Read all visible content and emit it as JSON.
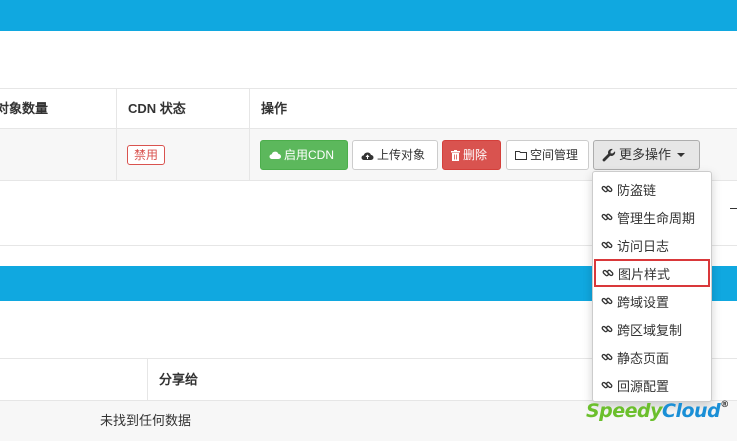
{
  "table1": {
    "headers": {
      "object_count": "对象数量",
      "cdn_status": "CDN 状态",
      "actions": "操作"
    },
    "row": {
      "cdn_status_badge": "禁用",
      "buttons": {
        "enable_cdn": "启用CDN",
        "upload": "上传对象",
        "delete": "删除",
        "space_manage": "空间管理",
        "more_actions": "更多操作"
      }
    }
  },
  "dropdown": {
    "items": [
      {
        "label": "防盗链",
        "icon": "link-icon"
      },
      {
        "label": "管理生命周期",
        "icon": "link-icon"
      },
      {
        "label": "访问日志",
        "icon": "link-icon"
      },
      {
        "label": "图片样式",
        "icon": "link-icon",
        "highlighted": true
      },
      {
        "label": "跨域设置",
        "icon": "link-icon"
      },
      {
        "label": "跨区域复制",
        "icon": "link-icon"
      },
      {
        "label": "静态页面",
        "icon": "link-icon"
      },
      {
        "label": "回源配置",
        "icon": "link-icon"
      }
    ]
  },
  "table2": {
    "headers": {
      "share_to": "分享给"
    },
    "empty_message": "未找到任何数据"
  },
  "watermark": {
    "part1": "Speedy",
    "part2": "Cloud",
    "mark": "®"
  },
  "colors": {
    "header_blue": "#10a8e0",
    "success_green": "#5cb85c",
    "danger_red": "#d9534f",
    "highlight_box": "#d9383a"
  }
}
